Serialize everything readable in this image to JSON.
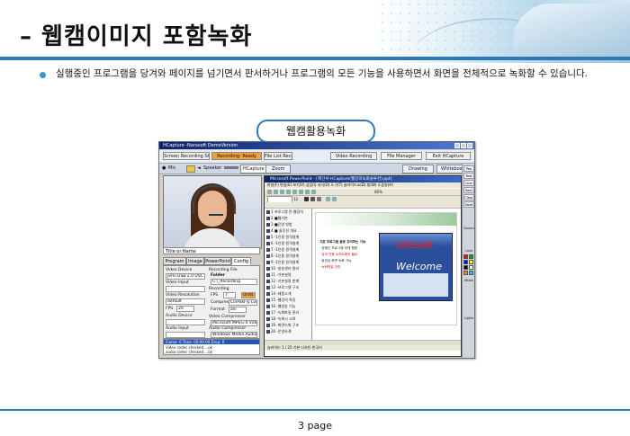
{
  "page": {
    "title": "– 웹캠이미지 포함녹화",
    "description": "실행중인 프로그램을 당겨와 페이지를 넘기면서 판서하거나 프로그램의 모든 기능을 사용하면서 화면을 전체적으로 녹화할 수 있습니다.",
    "section_label": "웹캠활용녹화",
    "page_number": "3 page"
  },
  "app": {
    "window_title": "HCapture -Narasoft DemoVersion",
    "buttons": {
      "screen_recording": "Screen Recording Start",
      "recording_status": "Recording: Ready",
      "file_list": "File List Recording",
      "video_recording": "Video Recording",
      "file_manager": "File Manager",
      "exit": "Exit HCapture"
    },
    "controls": {
      "mic": "Mic",
      "speaker": "Speaker",
      "device": "HCapture",
      "zoom": "Zoom",
      "drawing": "Drawing",
      "whiteboard": "Whiteboard"
    },
    "webcam_caption": "Title or Name",
    "tabs": [
      "Program",
      "Image",
      "PowerPoint",
      "Config"
    ],
    "config": {
      "video_device_label": "Video Device",
      "video_device_value": "Jemi USB 2.0 UVC",
      "video_input_label": "Video Input",
      "video_resolution_label": "Video Resolution",
      "video_resolution_value": "default",
      "fps_label": "FPS",
      "fps_value": "20",
      "audio_device_label": "Audio Device",
      "audio_input_label": "Audio Input",
      "recording_file_label": "Recording File",
      "folder_label": "Folder",
      "folder_value": "C:\\_Recording",
      "recording_label": "Recording",
      "fps2_label": "FPS",
      "fps2_value": "7",
      "unit_button": "Units",
      "compress_label": "Compress",
      "compress_value": "CinPakFly Lvl",
      "format_label": "Format",
      "format_value": "avi",
      "video_compressor_label": "Video Compressor",
      "video_compressor_value": "Microsoft MPEG-4 Video",
      "audio_compressor_label": "Audio Compressor",
      "audio_compressor_value": "Windows Media Audio"
    },
    "status": {
      "header": "Frame: 0   Time: 00:00:00   Drop: 0",
      "line1": "Video codec checked....ok",
      "line2": "audio codec checked....ok"
    }
  },
  "powerpoint": {
    "title": "Microsoft PowerPoint - [제안서-HCapture(웹강의녹화솔루션).ppt]",
    "menu": "파일(F)  편집(E)  보기(V)  삽입(I)  서식(O)  도구(T)  슬라이드쇼(D)  창(W)  도움말(H)",
    "font_size": "12",
    "zoom": "66%",
    "outline_items": [
      "1 프로그램 전-웹강의",
      "2 ■웹기본",
      "3 ■운영 방법",
      "4 ■ 솔루션 개요",
      "5 -1인용 원격설계",
      "6 -1인용 원격설계",
      "7 -1인용 원격설계",
      "8 -1인용 원격설계",
      "9 -1인용 원격설계",
      "10 -방송센터 원리",
      "11 -기본설명",
      "12 -기본설명 한계",
      "13 -프로그램 구조",
      "14 -제품소개",
      "15 -웹강의 특징",
      "16 -웹방송 기능",
      "17 -녹화파일 관리",
      "18 -녹화시 고려",
      "19 -화면녹화 구조",
      "20 -운영사례"
    ],
    "slide_text": [
      "기존 프로그램 활용 강의하는 기능",
      "· 정해진 프로그램 대체 활용",
      "· 강의 전용 소프트웨어 필요",
      "· 동영상 화면 녹화 가능",
      "· 녹화파일 관리"
    ],
    "web_logo": "나라소프트",
    "web_welcome": "Welcome",
    "status": "슬라이드 1 / 25      기본 디자인      한국어"
  },
  "sidebar": {
    "tools": [
      "Pen",
      "Text",
      "Line",
      "Rect",
      "Clear",
      "Save"
    ],
    "general_label": "General",
    "color_label": "Color",
    "width_label": "Width",
    "lights_label": "Lights",
    "swatches": [
      "#ff0000",
      "#00aa00",
      "#0000ff",
      "#ffff00",
      "#000000",
      "#ffffff",
      "#ff8800",
      "#00ccff"
    ]
  },
  "colors": {
    "accent_blue": "#2c79b8",
    "recording_orange": "#f2a03c",
    "title_bar": "#0a246a"
  }
}
